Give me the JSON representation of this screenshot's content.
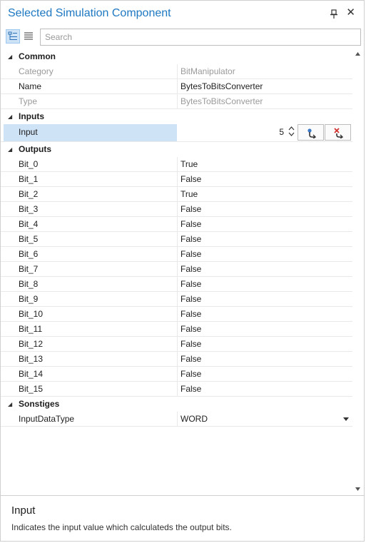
{
  "panel": {
    "title": "Selected Simulation Component"
  },
  "toolbar": {
    "search_placeholder": "Search"
  },
  "categories": {
    "common": {
      "label": "Common",
      "properties": [
        {
          "name": "Category",
          "value": "BitManipulator"
        },
        {
          "name": "Name",
          "value": "BytesToBitsConverter"
        },
        {
          "name": "Type",
          "value": "BytesToBitsConverter"
        }
      ]
    },
    "inputs": {
      "label": "Inputs",
      "input": {
        "name": "Input",
        "value": "5"
      }
    },
    "outputs": {
      "label": "Outputs",
      "bits": [
        {
          "name": "Bit_0",
          "value": "True"
        },
        {
          "name": "Bit_1",
          "value": "False"
        },
        {
          "name": "Bit_2",
          "value": "True"
        },
        {
          "name": "Bit_3",
          "value": "False"
        },
        {
          "name": "Bit_4",
          "value": "False"
        },
        {
          "name": "Bit_5",
          "value": "False"
        },
        {
          "name": "Bit_6",
          "value": "False"
        },
        {
          "name": "Bit_7",
          "value": "False"
        },
        {
          "name": "Bit_8",
          "value": "False"
        },
        {
          "name": "Bit_9",
          "value": "False"
        },
        {
          "name": "Bit_10",
          "value": "False"
        },
        {
          "name": "Bit_11",
          "value": "False"
        },
        {
          "name": "Bit_12",
          "value": "False"
        },
        {
          "name": "Bit_13",
          "value": "False"
        },
        {
          "name": "Bit_14",
          "value": "False"
        },
        {
          "name": "Bit_15",
          "value": "False"
        }
      ]
    },
    "sonstiges": {
      "label": "Sonstiges",
      "input_data_type": {
        "name": "InputDataType",
        "value": "WORD"
      }
    }
  },
  "description": {
    "title": "Input",
    "text": "Indicates the input value which calculateds the output bits."
  },
  "colors": {
    "title_blue": "#1e78c2",
    "selection": "#cfe3f7",
    "readonly_text": "#9a9a9a"
  },
  "icons": [
    "pin-icon",
    "close-icon",
    "categorized-view-icon",
    "alphabetical-view-icon",
    "expand-triangle-icon",
    "spin-updown-icon",
    "bind-connect-icon",
    "unbind-disconnect-icon",
    "dropdown-arrow-icon",
    "scroll-up-icon",
    "scroll-down-icon"
  ]
}
